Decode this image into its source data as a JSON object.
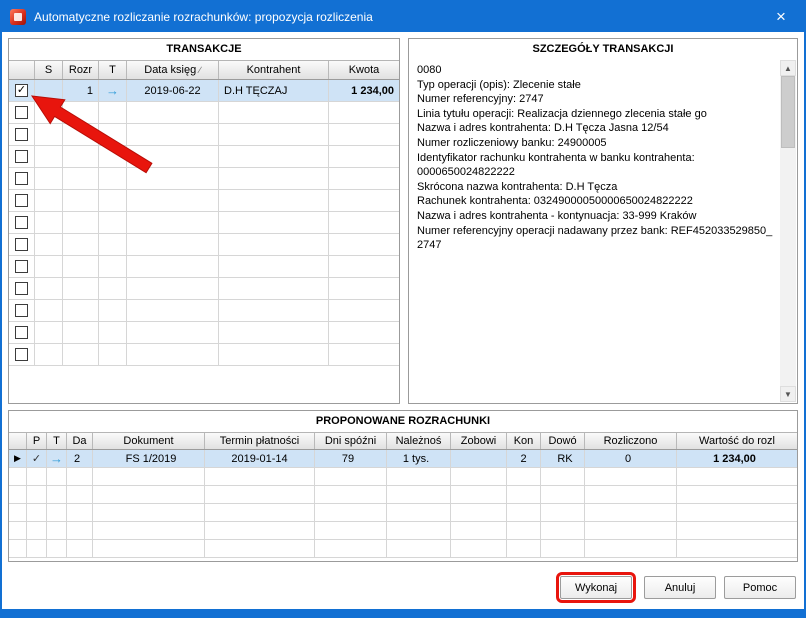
{
  "window": {
    "title": "Automatyczne rozliczanie rozrachunków: propozycja rozliczenia"
  },
  "icons": {
    "close": "×",
    "check": "✓",
    "row_arrow": "→",
    "marker": "▶",
    "scroll_up": "▲",
    "scroll_down": "▼",
    "sort": "∕"
  },
  "colors": {
    "titlebar_blue": "#1270d3",
    "selected_row": "#cfe3f6",
    "annotation_red": "#e8150d",
    "arrow_icon": "#2e9bd8"
  },
  "transactions": {
    "title": "TRANSAKCJE",
    "columns": {
      "s": "S",
      "rozr": "Rozr",
      "t": "T",
      "data": "Data księg",
      "kontrahent": "Kontrahent",
      "kwota": "Kwota"
    },
    "row": {
      "checked": "true",
      "rozr": "1",
      "data": "2019-06-22",
      "kontrahent": "D.H TĘCZAJ",
      "kwota": "1 234,00"
    }
  },
  "details": {
    "title": "SZCZEGÓŁY TRANSAKCJI",
    "lines": [
      "0080",
      "Typ operacji (opis): Zlecenie stałe",
      "Numer referencyjny: 2747",
      "Linia tytułu operacji: Realizacja dziennego zlecenia stałe go",
      "Nazwa i adres kontrahenta: D.H Tęcza  Jasna 12/54",
      "Numer rozliczeniowy banku: 24900005",
      "Identyfikator rachunku kontrahenta w banku kontrahenta:",
      "0000650024822222",
      "Skrócona nazwa kontrahenta: D.H Tęcza",
      "Rachunek kontrahenta: 03249000050000650024822222",
      "Nazwa i adres kontrahenta - kontynuacja: 33-999 Kraków",
      "Numer referencyjny operacji nadawany przez bank: REF452033529850_",
      "2747"
    ]
  },
  "proposed": {
    "title": "PROPONOWANE ROZRACHUNKI",
    "columns": {
      "p": "P",
      "t": "T",
      "da": "Da",
      "dokument": "Dokument",
      "termin": "Termin płatności",
      "dni": "Dni spóźni",
      "naleznosc": "Należnoś",
      "zobow": "Zobowi",
      "kon": "Kon",
      "dowod": "Dowó",
      "rozliczono": "Rozliczono",
      "wartosc": "Wartość do rozl"
    },
    "row": {
      "da": "2",
      "dokument": "FS 1/2019",
      "termin": "2019-01-14",
      "dni": "79",
      "naleznosc": "1 tys.",
      "kon": "2",
      "dowod": "RK",
      "rozliczono": "0",
      "wartosc": "1 234,00"
    }
  },
  "buttons": {
    "wykonaj": "Wykonaj",
    "anuluj": "Anuluj",
    "pomoc": "Pomoc"
  }
}
